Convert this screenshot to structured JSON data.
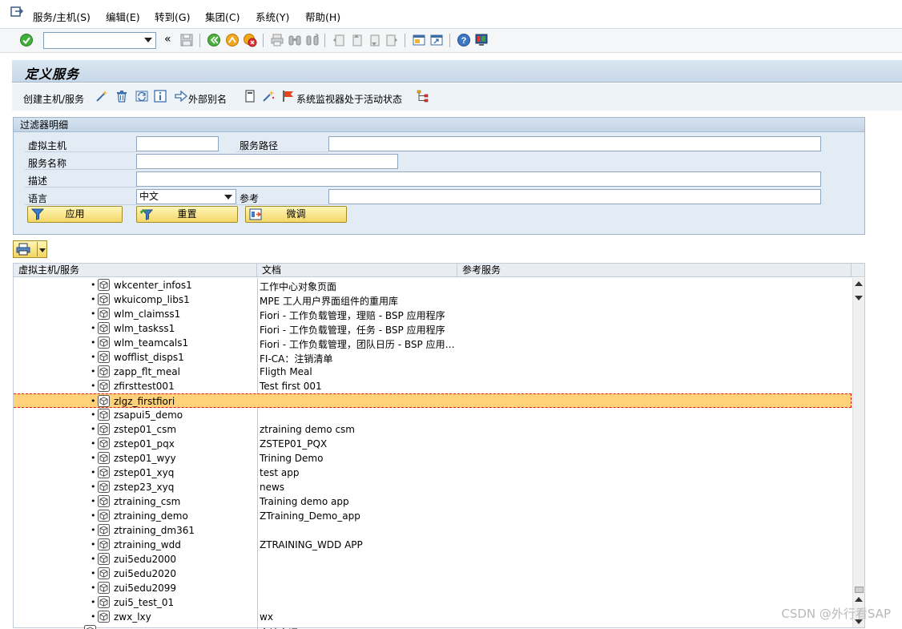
{
  "menu": {
    "items": [
      "服务/主机(S)",
      "编辑(E)",
      "转到(G)",
      "集团(C)",
      "系统(Y)",
      "帮助(H)"
    ]
  },
  "toolbar": {
    "command_value": "",
    "chevron": "«"
  },
  "page": {
    "title": "定义服务"
  },
  "app_toolbar": {
    "create_host_label": "创建主机/服务",
    "external_alias_label": "外部别名",
    "system_monitor_label": "系统监视器处于活动状态"
  },
  "filter": {
    "title": "过滤器明细",
    "virtual_host_label": "虚拟主机",
    "virtual_host_value": "",
    "service_path_label": "服务路径",
    "service_path_value": "",
    "service_name_label": "服务名称",
    "service_name_value": "",
    "description_label": "描述",
    "description_value": "",
    "language_label": "语言",
    "language_value": "中文",
    "reference_label": "参考",
    "reference_value": "",
    "apply_label": "应用",
    "reset_label": "重置",
    "finetune_label": "微调"
  },
  "table": {
    "headers": [
      "虚拟主机/服务",
      "文档",
      "参考服务"
    ],
    "rows": [
      {
        "name": "wkcenter_infos1",
        "doc": "工作中心对象页面"
      },
      {
        "name": "wkuicomp_libs1",
        "doc": "MPE 工人用户界面组件的重用库"
      },
      {
        "name": "wlm_claimss1",
        "doc": "Fiori - 工作负载管理，理赔 - BSP 应用程序"
      },
      {
        "name": "wlm_taskss1",
        "doc": "Fiori - 工作负载管理，任务 - BSP 应用程序"
      },
      {
        "name": "wlm_teamcals1",
        "doc": "Fiori - 工作负载管理，团队日历 - BSP 应用…"
      },
      {
        "name": "wofflist_disps1",
        "doc": "FI-CA：注销清单"
      },
      {
        "name": "zapp_flt_meal",
        "doc": "Fligth Meal"
      },
      {
        "name": "zfirsttest001",
        "doc": "Test first 001"
      },
      {
        "name": "zlgz_firstfiori",
        "doc": "",
        "selected": true
      },
      {
        "name": "zsapui5_demo",
        "doc": ""
      },
      {
        "name": "zstep01_csm",
        "doc": "ztraining demo csm"
      },
      {
        "name": "zstep01_pqx",
        "doc": "ZSTEP01_PQX"
      },
      {
        "name": "zstep01_wyy",
        "doc": "Trining Demo"
      },
      {
        "name": "zstep01_xyq",
        "doc": "test app"
      },
      {
        "name": "zstep23_xyq",
        "doc": "news"
      },
      {
        "name": "ztraining_csm",
        "doc": "Training demo app"
      },
      {
        "name": "ztraining_demo",
        "doc": "ZTraining_Demo_app"
      },
      {
        "name": "ztraining_dm361",
        "doc": ""
      },
      {
        "name": "ztraining_wdd",
        "doc": "ZTRAINING_WDD APP"
      },
      {
        "name": "zui5edu2000",
        "doc": ""
      },
      {
        "name": "zui5edu2020",
        "doc": ""
      },
      {
        "name": "zui5edu2099",
        "doc": ""
      },
      {
        "name": "zui5_test_01",
        "doc": ""
      },
      {
        "name": "zwx_lxy",
        "doc": "wx"
      },
      {
        "name": "",
        "doc": "会计文词"
      }
    ]
  },
  "watermark": "CSDN @外行看SAP",
  "colors": {
    "selected_row": "#ffd27a",
    "selection_border": "#e0161b",
    "title_bar": "#c7d8e8",
    "button": "#f4d868"
  }
}
